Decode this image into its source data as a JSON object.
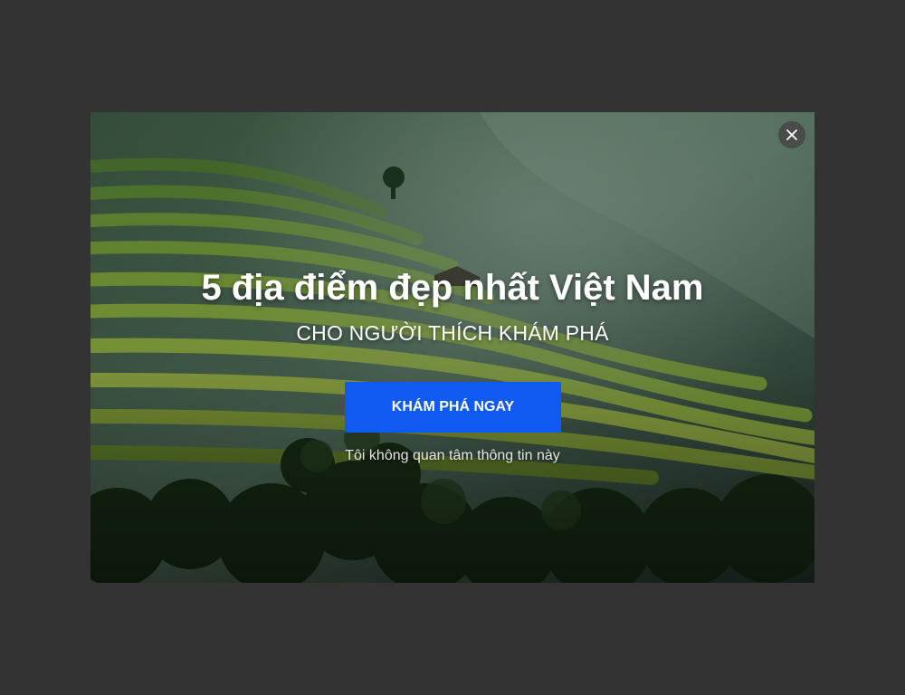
{
  "popup": {
    "title": "5 địa điểm đẹp nhất Việt Nam",
    "subtitle": "CHO NGƯỜI THÍCH KHÁM PHÁ",
    "cta_label": "KHÁM PHÁ NGAY",
    "dismiss_label": "Tôi không quan tâm thông tin này",
    "close_icon": "close-icon",
    "background": "rice-terrace-photo"
  },
  "colors": {
    "overlay_backdrop": "#333333",
    "cta_background": "#0f5af0",
    "text": "#ffffff"
  }
}
